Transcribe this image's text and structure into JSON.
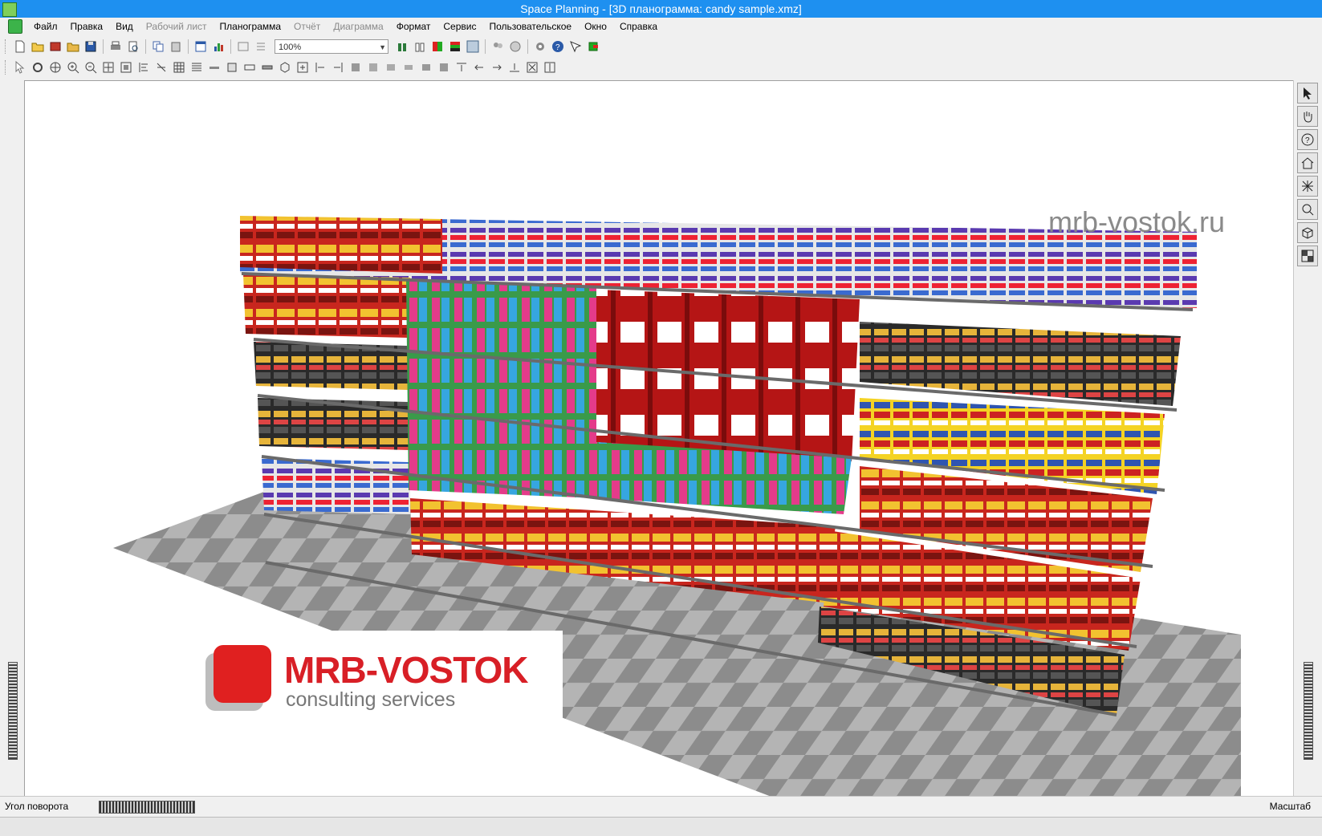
{
  "window": {
    "title": "Space Planning - [3D планограмма: candy sample.xmz]"
  },
  "menu": [
    {
      "label": "Файл",
      "disabled": false
    },
    {
      "label": "Правка",
      "disabled": false
    },
    {
      "label": "Вид",
      "disabled": false
    },
    {
      "label": "Рабочий лист",
      "disabled": true
    },
    {
      "label": "Планограмма",
      "disabled": false
    },
    {
      "label": "Отчёт",
      "disabled": true
    },
    {
      "label": "Диаграмма",
      "disabled": true
    },
    {
      "label": "Формат",
      "disabled": false
    },
    {
      "label": "Сервис",
      "disabled": false
    },
    {
      "label": "Пользовательское",
      "disabled": false
    },
    {
      "label": "Окно",
      "disabled": false
    },
    {
      "label": "Справка",
      "disabled": false
    }
  ],
  "toolbar": {
    "zoom_value": "100%"
  },
  "viewport": {
    "watermark": "mrb-vostok.ru",
    "brand_name": "MRB-VOSTOK",
    "brand_sub": "consulting services",
    "brand_color": "#d81f26"
  },
  "status": {
    "rotation_label": "Угол поворота",
    "scale_label": "Масштаб"
  }
}
